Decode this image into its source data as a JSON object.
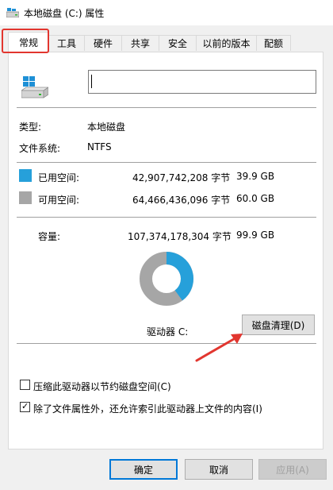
{
  "window": {
    "title": "本地磁盘 (C:) 属性"
  },
  "tabs": [
    {
      "label": "常规"
    },
    {
      "label": "工具"
    },
    {
      "label": "硬件"
    },
    {
      "label": "共享"
    },
    {
      "label": "安全"
    },
    {
      "label": "以前的版本"
    },
    {
      "label": "配额"
    }
  ],
  "general": {
    "name_value": "",
    "type_label": "类型:",
    "type_value": "本地磁盘",
    "fs_label": "文件系统:",
    "fs_value": "NTFS",
    "used": {
      "label": "已用空间:",
      "bytes": "42,907,742,208 字节",
      "size": "39.9 GB",
      "color": "#26a0da"
    },
    "free": {
      "label": "可用空间:",
      "bytes": "64,466,436,096 字节",
      "size": "60.0 GB",
      "color": "#a6a6a6"
    },
    "capacity": {
      "label": "容量:",
      "bytes": "107,374,178,304 字节",
      "size": "99.9 GB"
    },
    "used_fraction": 0.3996,
    "drive_label": "驱动器 C:",
    "cleanup_button": "磁盘清理(D)",
    "compress_label": "压缩此驱动器以节约磁盘空间(C)",
    "compress_checked": false,
    "index_label": "除了文件属性外，还允许索引此驱动器上文件的内容(I)",
    "index_checked": true
  },
  "footer": {
    "ok": "确定",
    "cancel": "取消",
    "apply": "应用(A)"
  },
  "annotation_color": "#e2362f"
}
